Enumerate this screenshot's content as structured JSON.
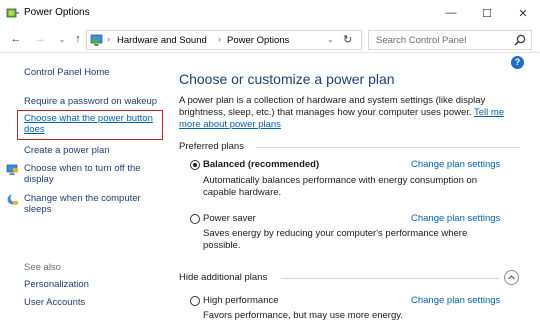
{
  "window": {
    "title": "Power Options",
    "minimize_glyph": "—",
    "maximize_glyph": "☐",
    "close_glyph": "✕"
  },
  "nav": {
    "back_glyph": "←",
    "forward_glyph": "→",
    "dropdown_glyph": "⌄",
    "up_glyph": "↑",
    "breadcrumbs": [
      "Hardware and Sound",
      "Power Options"
    ],
    "separator": "›",
    "refresh_glyph": "↻",
    "search_placeholder": "Search Control Panel"
  },
  "sidebar": {
    "home": "Control Panel Home",
    "links": [
      "Require a password on wakeup",
      "Choose what the power button does",
      "Create a power plan",
      "Choose when to turn off the display",
      "Change when the computer sleeps"
    ],
    "see_also_label": "See also",
    "see_also": [
      "Personalization",
      "User Accounts"
    ]
  },
  "main": {
    "help": "?",
    "title": "Choose or customize a power plan",
    "description": "A power plan is a collection of hardware and system settings (like display brightness, sleep, etc.) that manages how your computer uses power.",
    "tell_me_more": "Tell me more about power plans",
    "preferred_label": "Preferred plans",
    "hide_label": "Hide additional plans",
    "change_label": "Change plan settings",
    "plans": [
      {
        "name": "Balanced (recommended)",
        "selected": true,
        "desc": "Automatically balances performance with energy consumption on capable hardware."
      },
      {
        "name": "Power saver",
        "selected": false,
        "desc": "Saves energy by reducing your computer's performance where possible."
      },
      {
        "name": "High performance",
        "selected": false,
        "desc": "Favors performance, but may use more energy."
      }
    ]
  },
  "colors": {
    "link": "#0063b1",
    "heading": "#1e3f76",
    "highlight_box": "#c4262e"
  }
}
